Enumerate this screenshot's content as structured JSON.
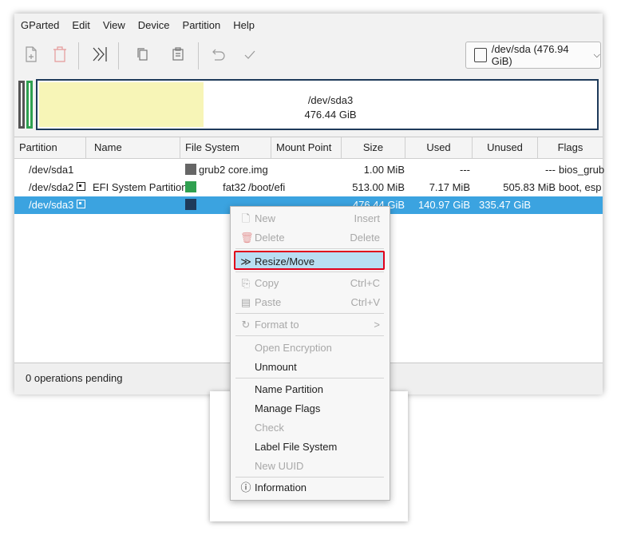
{
  "menu": [
    "GParted",
    "Edit",
    "View",
    "Device",
    "Partition",
    "Help"
  ],
  "device_selector": {
    "label": "/dev/sda (476.94 GiB)"
  },
  "disk_map": {
    "name": "/dev/sda3",
    "size": "476.44 GiB",
    "used_fraction": 0.296
  },
  "columns": [
    "Partition",
    "Name",
    "File System",
    "Mount Point",
    "Size",
    "Used",
    "Unused",
    "Flags"
  ],
  "rows": [
    {
      "partition": "/dev/sda1",
      "name": "",
      "fs": "grub2 core.img",
      "fs_color": "#666666",
      "mount": "",
      "size": "1.00 MiB",
      "used": "---",
      "unused": "---",
      "flags": "bios_grub"
    },
    {
      "partition": "/dev/sda2",
      "name": "EFI System Partition",
      "fs": "fat32",
      "fs_color": "#2fa050",
      "mount": "/boot/efi",
      "size": "513.00 MiB",
      "used": "7.17 MiB",
      "unused": "505.83 MiB",
      "flags": "boot, esp"
    },
    {
      "partition": "/dev/sda3",
      "name": "",
      "fs": "",
      "fs_color": "#1e3a5a",
      "mount": "",
      "size": "476.44 GiB",
      "used": "140.97 GiB",
      "unused": "335.47 GiB",
      "flags": ""
    }
  ],
  "status": "0 operations pending",
  "context_menu": {
    "new": {
      "label": "New",
      "shortcut": "Insert"
    },
    "delete": {
      "label": "Delete",
      "shortcut": "Delete"
    },
    "resize": {
      "label": "Resize/Move"
    },
    "copy": {
      "label": "Copy",
      "shortcut": "Ctrl+C"
    },
    "paste": {
      "label": "Paste",
      "shortcut": "Ctrl+V"
    },
    "format": {
      "label": "Format to",
      "arrow": ">"
    },
    "open_encryption": {
      "label": "Open Encryption"
    },
    "unmount": {
      "label": "Unmount"
    },
    "name_partition": {
      "label": "Name Partition"
    },
    "manage_flags": {
      "label": "Manage Flags"
    },
    "check": {
      "label": "Check"
    },
    "label_fs": {
      "label": "Label File System"
    },
    "new_uuid": {
      "label": "New UUID"
    },
    "information": {
      "label": "Information"
    }
  },
  "colors": {
    "selection": "#3ba3e0",
    "highlight_border": "#e0001b",
    "unallocated_used": "#f7f5b7"
  }
}
